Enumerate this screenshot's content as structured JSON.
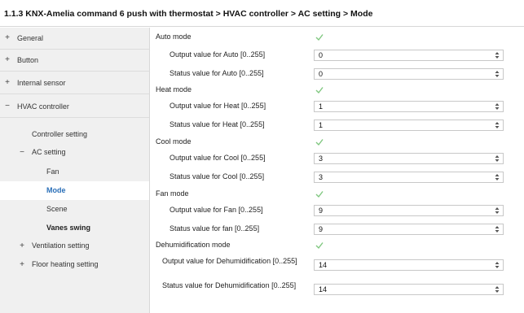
{
  "header": {
    "title": "1.1.3 KNX-Amelia command 6 push with thermostat > HVAC controller > AC setting > Mode"
  },
  "sidebar": {
    "items": [
      {
        "sign": "+",
        "label": "General"
      },
      {
        "sign": "+",
        "label": "Button"
      },
      {
        "sign": "+",
        "label": "Internal sensor"
      },
      {
        "sign": "−",
        "label": "HVAC controller"
      },
      {
        "sign": "",
        "label": "Controller setting"
      },
      {
        "sign": "−",
        "label": "AC setting"
      },
      {
        "sign": "",
        "label": "Fan"
      },
      {
        "sign": "",
        "label": "Mode"
      },
      {
        "sign": "",
        "label": "Scene"
      },
      {
        "sign": "",
        "label": "Vanes swing"
      },
      {
        "sign": "+",
        "label": "Ventilation setting"
      },
      {
        "sign": "+",
        "label": "Floor heating setting"
      }
    ]
  },
  "colors": {
    "selected_text": "#2a6fb8",
    "check": "#7fc77f",
    "sidebar_bg": "#f0f0f0"
  },
  "main": {
    "rows": [
      {
        "label": "Auto mode",
        "checked": true
      },
      {
        "label": "Output value for Auto [0..255]",
        "value": "0"
      },
      {
        "label": "Status value for Auto [0..255]",
        "value": "0"
      },
      {
        "label": "Heat mode",
        "checked": true
      },
      {
        "label": "Output value for Heat [0..255]",
        "value": "1"
      },
      {
        "label": "Status value for Heat [0..255]",
        "value": "1"
      },
      {
        "label": "Cool mode",
        "checked": true
      },
      {
        "label": "Output value for Cool [0..255]",
        "value": "3"
      },
      {
        "label": "Status value for Cool [0..255]",
        "value": "3"
      },
      {
        "label": "Fan mode",
        "checked": true
      },
      {
        "label": "Output value for Fan [0..255]",
        "value": "9"
      },
      {
        "label": "Status value for fan [0..255]",
        "value": "9"
      },
      {
        "label": "Dehumidification mode",
        "checked": true
      },
      {
        "label": "Output value for Dehumidification [0..255]",
        "value": "14"
      },
      {
        "label": "Status value for Dehumidification [0..255]",
        "value": "14"
      }
    ]
  }
}
